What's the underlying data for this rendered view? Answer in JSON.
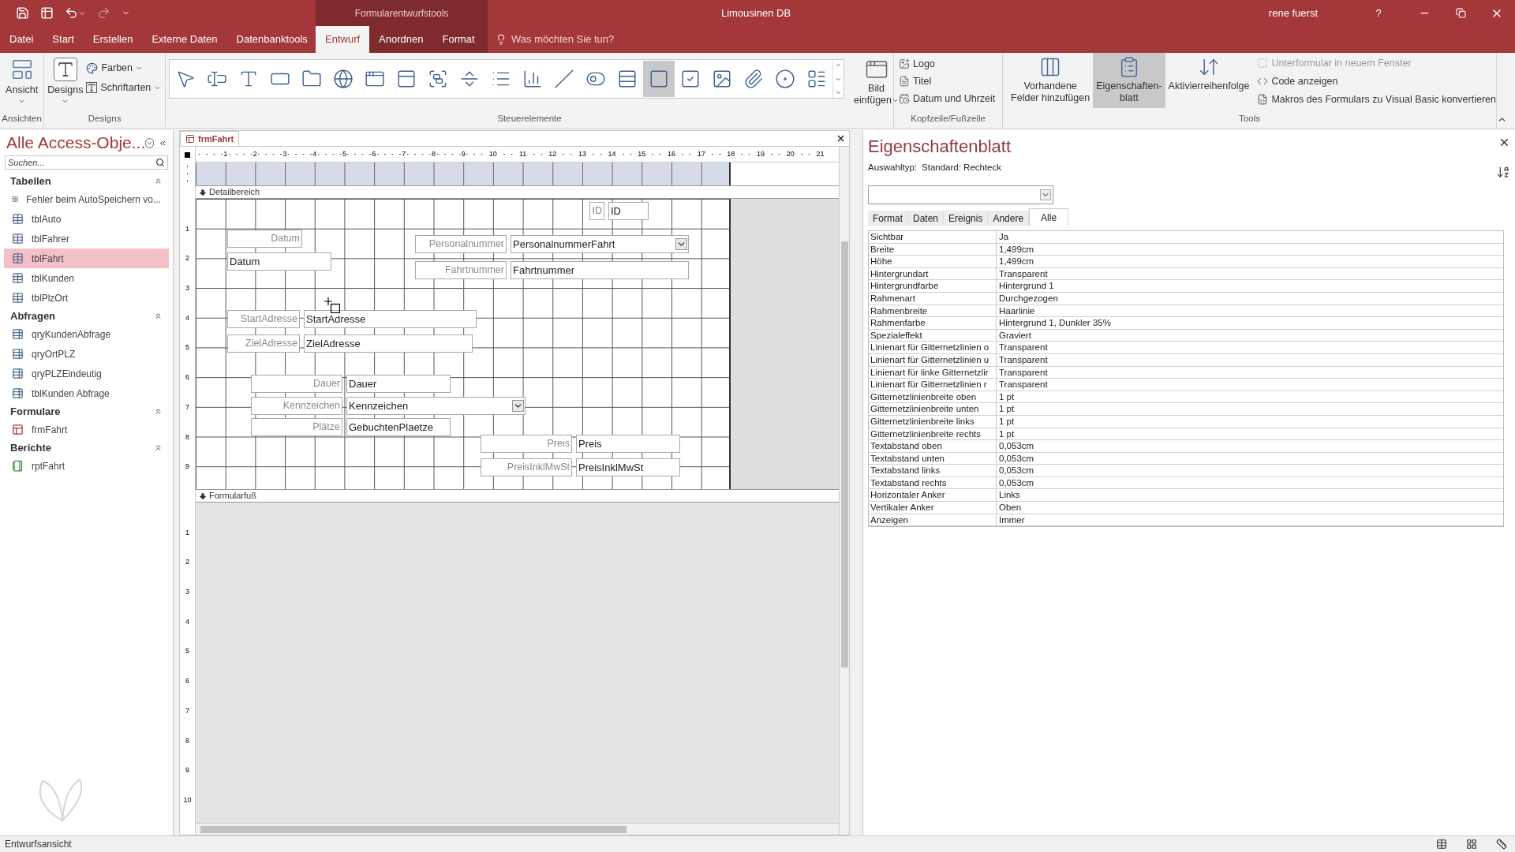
{
  "title_bar": {
    "context_header": "Formularentwurfstools",
    "title": "Limousinen DB",
    "user": "rene fuerst",
    "help": "?"
  },
  "menu_tabs": [
    {
      "label": "Datei",
      "selected": false,
      "contextual": false
    },
    {
      "label": "Start",
      "selected": false,
      "contextual": false
    },
    {
      "label": "Erstellen",
      "selected": false,
      "contextual": false
    },
    {
      "label": "Externe Daten",
      "selected": false,
      "contextual": false
    },
    {
      "label": "Datenbanktools",
      "selected": false,
      "contextual": false
    },
    {
      "label": "Entwurf",
      "selected": true,
      "contextual": true
    },
    {
      "label": "Anordnen",
      "selected": false,
      "contextual": true
    },
    {
      "label": "Format",
      "selected": false,
      "contextual": true
    }
  ],
  "tell_me": {
    "placeholder": "Was möchten Sie tun?"
  },
  "ribbon": {
    "views": {
      "button": "Ansicht",
      "group": "Ansichten"
    },
    "designs": {
      "button": "Designs",
      "colors": "Farben",
      "fonts": "Schriftarten",
      "group": "Designs"
    },
    "controls": {
      "group": "Steuerelemente",
      "items": [
        {
          "kind": "pointer",
          "selected": false
        },
        {
          "kind": "textbox",
          "selected": false
        },
        {
          "kind": "label",
          "selected": false
        },
        {
          "kind": "button",
          "selected": false
        },
        {
          "kind": "tab",
          "selected": false
        },
        {
          "kind": "hyperlink",
          "selected": false
        },
        {
          "kind": "browser",
          "selected": false
        },
        {
          "kind": "navigation",
          "selected": false
        },
        {
          "kind": "optiongroup",
          "selected": false
        },
        {
          "kind": "pagebreak",
          "selected": false
        },
        {
          "kind": "combobox",
          "selected": false
        },
        {
          "kind": "chart",
          "selected": false
        },
        {
          "kind": "line",
          "selected": false
        },
        {
          "kind": "toggle",
          "selected": false
        },
        {
          "kind": "listbox",
          "selected": false
        },
        {
          "kind": "rectangle",
          "selected": true
        },
        {
          "kind": "checkbox",
          "selected": false
        },
        {
          "kind": "image",
          "selected": false
        },
        {
          "kind": "attachment",
          "selected": false
        },
        {
          "kind": "radio",
          "selected": false
        },
        {
          "kind": "subform",
          "selected": false
        }
      ],
      "insert_image": [
        "Bild",
        "einfügen"
      ]
    },
    "header_footer": {
      "group": "Kopfzeile/Fußzeile",
      "items": [
        {
          "kind": "logo",
          "label": "Logo"
        },
        {
          "kind": "title",
          "label": "Titel"
        },
        {
          "kind": "datetime",
          "label": "Datum und Uhrzeit"
        }
      ]
    },
    "tools": {
      "group": "Tools",
      "buttons": [
        {
          "kind": "fields",
          "lines": [
            "Vorhandene",
            "Felder hinzufügen"
          ],
          "selected": false
        },
        {
          "kind": "properties",
          "lines": [
            "Eigenschaften-",
            "blatt"
          ],
          "selected": true
        },
        {
          "kind": "taborder",
          "lines": [
            "Aktivierreihenfolge"
          ],
          "selected": false
        }
      ],
      "small": [
        {
          "kind": "subform",
          "label": "Unterformular in neuem Fenster",
          "disabled": true
        },
        {
          "kind": "code",
          "label": "Code anzeigen",
          "disabled": false
        },
        {
          "kind": "macro",
          "label": "Makros des Formulars zu Visual Basic konvertieren",
          "disabled": false
        }
      ]
    }
  },
  "nav": {
    "title": "Alle Access-Obje...",
    "search_placeholder": "Suchen...",
    "groups": [
      {
        "label": "Tabellen",
        "expanded": true,
        "items": [
          {
            "kind": "table",
            "label": "Fehler beim AutoSpeichern vo...",
            "selected": false
          },
          {
            "kind": "table",
            "label": "tblAuto",
            "selected": false
          },
          {
            "kind": "table",
            "label": "tblFahrer",
            "selected": false
          },
          {
            "kind": "table",
            "label": "tblFahrt",
            "selected": true
          },
          {
            "kind": "table",
            "label": "tblKunden",
            "selected": false
          },
          {
            "kind": "table",
            "label": "tblPlzOrt",
            "selected": false
          }
        ]
      },
      {
        "label": "Abfragen",
        "expanded": true,
        "items": [
          {
            "kind": "query",
            "label": "qryKundenAbfrage",
            "selected": false
          },
          {
            "kind": "query",
            "label": "qryOrtPLZ",
            "selected": false
          },
          {
            "kind": "query",
            "label": "qryPLZEindeutig",
            "selected": false
          },
          {
            "kind": "query",
            "label": "tblKunden Abfrage",
            "selected": false
          }
        ]
      },
      {
        "label": "Formulare",
        "expanded": true,
        "items": [
          {
            "kind": "form",
            "label": "frmFahrt",
            "selected": false
          }
        ]
      },
      {
        "label": "Berichte",
        "expanded": true,
        "items": [
          {
            "kind": "report",
            "label": "rptFahrt",
            "selected": false
          }
        ]
      }
    ]
  },
  "document": {
    "tab": "frmFahrt",
    "ruler": [
      "1",
      "2",
      "3",
      "4",
      "5",
      "6",
      "7",
      "8",
      "9",
      "10",
      "11",
      "12",
      "13",
      "14",
      "15",
      "16",
      "17",
      "18",
      "19",
      "20",
      "21"
    ],
    "detail_ruler": [
      "1",
      "2",
      "3",
      "4",
      "5",
      "6",
      "7",
      "8",
      "9"
    ],
    "footer_ruler": [
      "1",
      "2",
      "3",
      "4",
      "5",
      "6",
      "7",
      "8",
      "9",
      "10"
    ],
    "detail_label": "Detailbereich",
    "footer_label": "Formularfuß",
    "controls": [
      {
        "kind": "label",
        "text": "ID"
      },
      {
        "kind": "textbox",
        "text": "ID"
      },
      {
        "kind": "label",
        "text": "Datum"
      },
      {
        "kind": "label",
        "text": "Personalnummer"
      },
      {
        "kind": "combobox",
        "text": "PersonalnummerFahrt"
      },
      {
        "kind": "textbox",
        "text": "Datum"
      },
      {
        "kind": "label",
        "text": "Fahrtnummer"
      },
      {
        "kind": "textbox",
        "text": "Fahrtnummer"
      },
      {
        "kind": "label",
        "text": "StartAdresse"
      },
      {
        "kind": "textbox",
        "text": "StartAdresse"
      },
      {
        "kind": "label",
        "text": "ZielAdresse"
      },
      {
        "kind": "textbox",
        "text": "ZielAdresse"
      },
      {
        "kind": "label",
        "text": "Dauer"
      },
      {
        "kind": "textbox",
        "text": "Dauer"
      },
      {
        "kind": "label",
        "text": "Kennzeichen"
      },
      {
        "kind": "combobox",
        "text": "Kennzeichen"
      },
      {
        "kind": "label",
        "text": "Plätze"
      },
      {
        "kind": "textbox",
        "text": "GebuchtenPlaetze"
      },
      {
        "kind": "label",
        "text": "Preis"
      },
      {
        "kind": "textbox",
        "text": "Preis"
      },
      {
        "kind": "label",
        "text": "PreisInklMwSt"
      },
      {
        "kind": "textbox",
        "text": "PreisInklMwSt"
      }
    ]
  },
  "property_sheet": {
    "title": "Eigenschaftenblatt",
    "selection_label": "Auswahltyp:",
    "selection_type": "Standard: Rechteck",
    "tabs": [
      {
        "label": "Format",
        "selected": false
      },
      {
        "label": "Daten",
        "selected": false
      },
      {
        "label": "Ereignis",
        "selected": false
      },
      {
        "label": "Andere",
        "selected": false
      },
      {
        "label": "Alle",
        "selected": true
      }
    ],
    "rows": [
      {
        "name": "Sichtbar",
        "value": "Ja"
      },
      {
        "name": "Breite",
        "value": "1,499cm"
      },
      {
        "name": "Höhe",
        "value": "1,499cm"
      },
      {
        "name": "Hintergrundart",
        "value": "Transparent"
      },
      {
        "name": "Hintergrundfarbe",
        "value": "Hintergrund 1"
      },
      {
        "name": "Rahmenart",
        "value": "Durchgezogen"
      },
      {
        "name": "Rahmenbreite",
        "value": "Haarlinie"
      },
      {
        "name": "Rahmenfarbe",
        "value": "Hintergrund 1, Dunkler 35%"
      },
      {
        "name": "Spezialeffekt",
        "value": "Graviert"
      },
      {
        "name": "Linienart für Gitternetzlinien o",
        "value": "Transparent"
      },
      {
        "name": "Linienart für Gitternetzlinien u",
        "value": "Transparent"
      },
      {
        "name": "Linienart für linke Gitternetzlir",
        "value": "Transparent"
      },
      {
        "name": "Linienart für Gitternetzlinien r",
        "value": "Transparent"
      },
      {
        "name": "Gitternetzlinienbreite oben",
        "value": "1 pt"
      },
      {
        "name": "Gitternetzlinienbreite unten",
        "value": "1 pt"
      },
      {
        "name": "Gitternetzlinienbreite links",
        "value": "1 pt"
      },
      {
        "name": "Gitternetzlinienbreite rechts",
        "value": "1 pt"
      },
      {
        "name": "Textabstand oben",
        "value": "0,053cm"
      },
      {
        "name": "Textabstand unten",
        "value": "0,053cm"
      },
      {
        "name": "Textabstand links",
        "value": "0,053cm"
      },
      {
        "name": "Textabstand rechts",
        "value": "0,053cm"
      },
      {
        "name": "Horizontaler Anker",
        "value": "Links"
      },
      {
        "name": "Vertikaler Anker",
        "value": "Oben"
      },
      {
        "name": "Anzeigen",
        "value": "Immer"
      }
    ]
  },
  "status_bar": {
    "text": "Entwurfsansicht"
  }
}
